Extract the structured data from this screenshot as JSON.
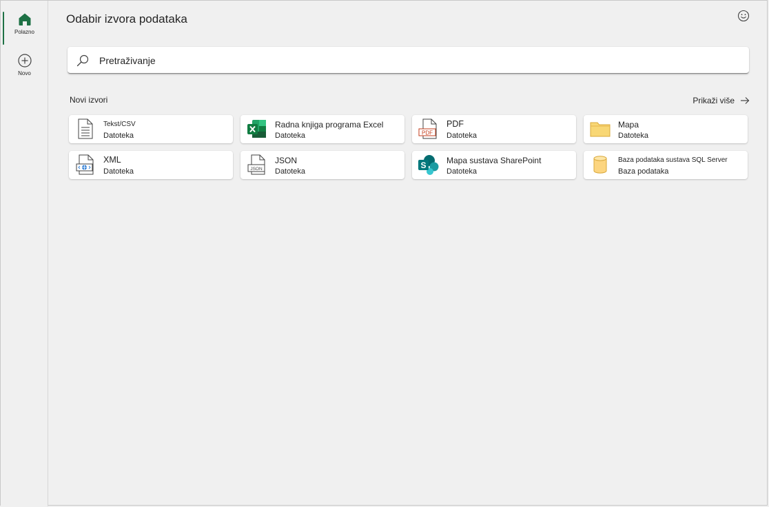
{
  "rail": {
    "home_label": "Polazno",
    "new_label": "Novo"
  },
  "header": {
    "title": "Odabir izvora podataka"
  },
  "search": {
    "placeholder": "Pretraživanje"
  },
  "sources": {
    "section_title": "Novi izvori",
    "show_more": "Prikaži više",
    "items": [
      {
        "name": "Tekst/CSV",
        "type": "Datoteka",
        "icon": "text-file-icon"
      },
      {
        "name": "Radna knjiga programa Excel",
        "type": "Datoteka",
        "icon": "excel-icon"
      },
      {
        "name": "PDF",
        "type": "Datoteka",
        "icon": "pdf-icon"
      },
      {
        "name": "Mapa",
        "type": "Datoteka",
        "icon": "folder-icon"
      },
      {
        "name": "XML",
        "type": "Datoteka",
        "icon": "xml-file-icon"
      },
      {
        "name": "JSON",
        "type": "Datoteka",
        "icon": "json-file-icon"
      },
      {
        "name": "Mapa sustava SharePoint",
        "type": "Datoteka",
        "icon": "sharepoint-icon"
      },
      {
        "name": "Baza podataka sustava SQL Server",
        "type": "Baza podataka",
        "icon": "database-icon"
      }
    ]
  },
  "colors": {
    "accent": "#1e7145",
    "background": "#f0f0f0",
    "card": "#ffffff",
    "folder": "#f8d775",
    "database": "#fcd580",
    "pdf_red": "#c43e1c",
    "sharepoint": "#036c70"
  }
}
